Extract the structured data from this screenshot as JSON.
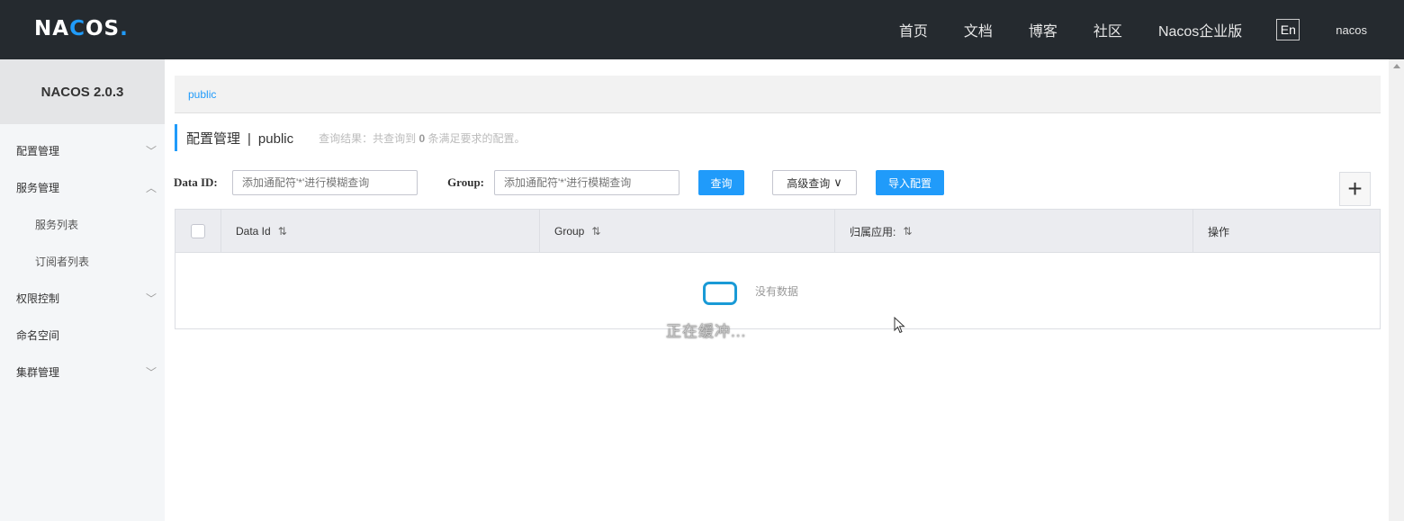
{
  "header": {
    "logo_text_1": "NA",
    "logo_text_2": "C",
    "logo_text_3": "OS",
    "logo_dot": ".",
    "nav": [
      "首页",
      "文档",
      "博客",
      "社区",
      "Nacos企业版"
    ],
    "lang": "En",
    "user": "nacos"
  },
  "sidebar": {
    "version": "NACOS 2.0.3",
    "items": [
      {
        "label": "配置管理",
        "chevron": "﹀"
      },
      {
        "label": "服务管理",
        "chevron": "︿"
      },
      {
        "label": "服务列表",
        "chevron": ""
      },
      {
        "label": "订阅者列表",
        "chevron": ""
      },
      {
        "label": "权限控制",
        "chevron": "﹀"
      },
      {
        "label": "命名空间",
        "chevron": ""
      },
      {
        "label": "集群管理",
        "chevron": "﹀"
      }
    ]
  },
  "breadcrumb": {
    "namespace": "public"
  },
  "page": {
    "title": "配置管理",
    "separator": "|",
    "namespace": "public",
    "summary_prefix": "查询结果：共查询到",
    "summary_count": "0",
    "summary_suffix": "条满足要求的配置。"
  },
  "search": {
    "data_id_label": "Data ID:",
    "data_id_placeholder": "添加通配符'*'进行模糊查询",
    "group_label": "Group:",
    "group_placeholder": "添加通配符'*'进行模糊查询",
    "query_button": "查询",
    "advanced_button": "高级查询",
    "advanced_chevron": "∨",
    "import_button": "导入配置",
    "add_button": "+"
  },
  "table": {
    "columns": [
      {
        "label": "Data Id",
        "sort": "⇅"
      },
      {
        "label": "Group",
        "sort": "⇅"
      },
      {
        "label": "归属应用:",
        "sort": "⇅"
      },
      {
        "label": "操作",
        "sort": ""
      }
    ],
    "empty_text": "没有数据"
  },
  "overlay": {
    "buffering_text": "正在缓冲..."
  }
}
